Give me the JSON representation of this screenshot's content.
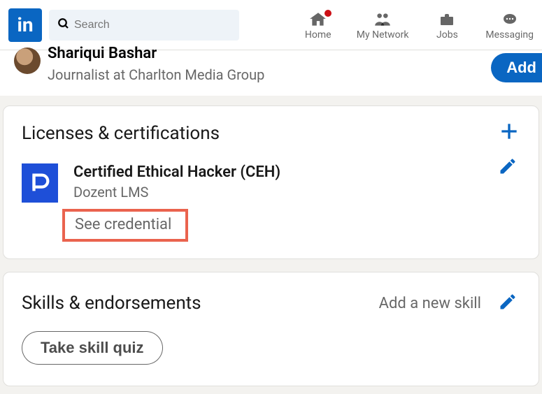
{
  "header": {
    "logo_text": "in",
    "search_placeholder": "Search",
    "nav": {
      "home": "Home",
      "network": "My Network",
      "jobs": "Jobs",
      "messaging": "Messaging"
    }
  },
  "profile": {
    "name": "Shariqui Bashar",
    "title": "Journalist at Charlton Media Group",
    "add_button": "Add"
  },
  "licenses": {
    "heading": "Licenses & certifications",
    "cert": {
      "title": "Certified Ethical Hacker (CEH)",
      "org": "Dozent LMS",
      "credential_link": "See credential"
    }
  },
  "skills": {
    "heading": "Skills & endorsements",
    "add_link": "Add a new skill",
    "quiz_button": "Take skill quiz"
  }
}
